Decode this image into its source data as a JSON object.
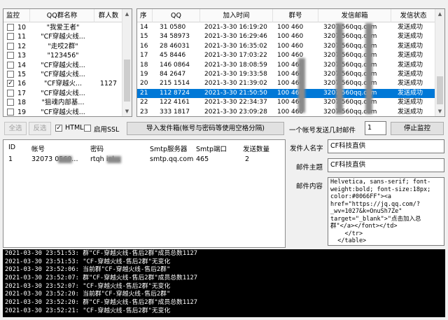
{
  "groups": {
    "headers": [
      "监控",
      "QQ群名称",
      "群人数"
    ],
    "rows": [
      {
        "checked": false,
        "num": "10",
        "name": "\"我爱王者\"",
        "count": ""
      },
      {
        "checked": false,
        "num": "11",
        "name": "\"CF穿越火线...",
        "count": ""
      },
      {
        "checked": false,
        "num": "12",
        "name": "\"走哎2群\"",
        "count": ""
      },
      {
        "checked": false,
        "num": "13",
        "name": "\"123456\"",
        "count": ""
      },
      {
        "checked": false,
        "num": "14",
        "name": "\"CF穿越火线...",
        "count": ""
      },
      {
        "checked": false,
        "num": "15",
        "name": "\"CF穿越火线...",
        "count": ""
      },
      {
        "checked": true,
        "num": "16",
        "name": "\"CF穿越火...",
        "count": "1127"
      },
      {
        "checked": false,
        "num": "17",
        "name": "\"CF穿越火线...",
        "count": ""
      },
      {
        "checked": false,
        "num": "18",
        "name": "\"狙魂内部基...",
        "count": ""
      },
      {
        "checked": false,
        "num": "19",
        "name": "\"CF穿越火线...",
        "count": ""
      }
    ]
  },
  "sends": {
    "headers": [
      "序",
      "QQ",
      "加入时间",
      "群号",
      "发信邮箱",
      "发信状态"
    ],
    "rows": [
      {
        "seq": "14",
        "qq": "31   0580",
        "time": "2021-3-30 16:19:20",
        "group": "100   460",
        "email": "3207    560qq.com",
        "status": "发送成功",
        "selected": false
      },
      {
        "seq": "15",
        "qq": "34   58973",
        "time": "2021-3-30 16:29:46",
        "group": "100   460",
        "email": "3207    560qq.com",
        "status": "发送成功",
        "selected": false
      },
      {
        "seq": "16",
        "qq": "28   46031",
        "time": "2021-3-30 16:35:02",
        "group": "100   460",
        "email": "3207    560qq.com",
        "status": "发送成功",
        "selected": false
      },
      {
        "seq": "17",
        "qq": "45   8446",
        "time": "2021-3-30 17:03:22",
        "group": "100   460",
        "email": "3207    560qq.com",
        "status": "发送成功",
        "selected": false
      },
      {
        "seq": "18",
        "qq": "146   0864",
        "time": "2021-3-30 18:08:59",
        "group": "100   460",
        "email": "3207    560qq.com",
        "status": "发送成功",
        "selected": false
      },
      {
        "seq": "19",
        "qq": "84   2647",
        "time": "2021-3-30 19:33:58",
        "group": "100   460",
        "email": "3207    560qq.com",
        "status": "发送成功",
        "selected": false
      },
      {
        "seq": "20",
        "qq": "215   1514",
        "time": "2021-3-30 21:39:02",
        "group": "100   460",
        "email": "3207    560qq.com",
        "status": "发送成功",
        "selected": false
      },
      {
        "seq": "21",
        "qq": "112   8724",
        "time": "2021-3-30 21:50:50",
        "group": "100   460",
        "email": "3207    560qq.com",
        "status": "发送成功",
        "selected": true
      },
      {
        "seq": "22",
        "qq": "122   4161",
        "time": "2021-3-30 22:34:37",
        "group": "100   460",
        "email": "3207    560qq.com",
        "status": "发送成功",
        "selected": false
      },
      {
        "seq": "23",
        "qq": "333   1817",
        "time": "2021-3-30 23:09:28",
        "group": "100   460",
        "email": "3207    560qq.com",
        "status": "发送成功",
        "selected": false
      }
    ]
  },
  "toolbar": {
    "select_all": "全选",
    "invert": "反选",
    "html_label": "HTML",
    "html_checked": true,
    "ssl_label": "启用SSL",
    "ssl_checked": false,
    "import_button": "导入发件箱(帐号与密码等使用空格分隔)",
    "per_account_label": "一个帐号发送几封邮件",
    "per_account_value": "1",
    "stop_button": "停止监控"
  },
  "accounts": {
    "headers": [
      "ID",
      "帐号",
      "密码",
      "Smtp服务器",
      "Smtp端口",
      "发送数量"
    ],
    "rows": [
      {
        "id": "1",
        "account": "32073   0560...",
        "password": "rtqh   inl...",
        "server": "smtp.qq.com",
        "port": "465",
        "count": "2"
      }
    ]
  },
  "compose": {
    "sender_label": "发件人名字",
    "sender_value": "CF科技直供",
    "subject_label": "邮件主题",
    "subject_value": "CF科技直供",
    "content_label": "邮件内容",
    "content_lines": [
      "Helvetica, sans-serif; font-",
      "weight:bold; font-size:18px;",
      "color:#0066FF\"><a",
      "href=\"https://jq.qq.com/?",
      "_wv=1027&k=OnuSh7Ze\"",
      "target=\"_blank\">\"点击加入总",
      "群\"</a></font></td>",
      "    </tr>",
      "  </table>"
    ]
  },
  "log": [
    "2021-03-30 23:51:53: 群\"CF-穿越火线-售后2群\"成员总数1127",
    "2021-03-30 23:51:53: \"CF-穿越火线-售后2群\"无变化",
    "2021-03-30 23:52:06: 当前群\"CF-穿越火线-售后2群\"",
    "2021-03-30 23:52:07: 群\"CF-穿越火线-售后2群\"成员总数1127",
    "2021-03-30 23:52:07: \"CF-穿越火线-售后2群\"无变化",
    "2021-03-30 23:52:20: 当前群\"CF-穿越火线-售后2群\"",
    "2021-03-30 23:52:20: 群\"CF-穿越火线-售后2群\"成员总数1127",
    "2021-03-30 23:52:21: \"CF-穿越火线-售后2群\"无变化"
  ],
  "colors": {
    "selection": "#0078d7",
    "log_background": "#000000"
  }
}
